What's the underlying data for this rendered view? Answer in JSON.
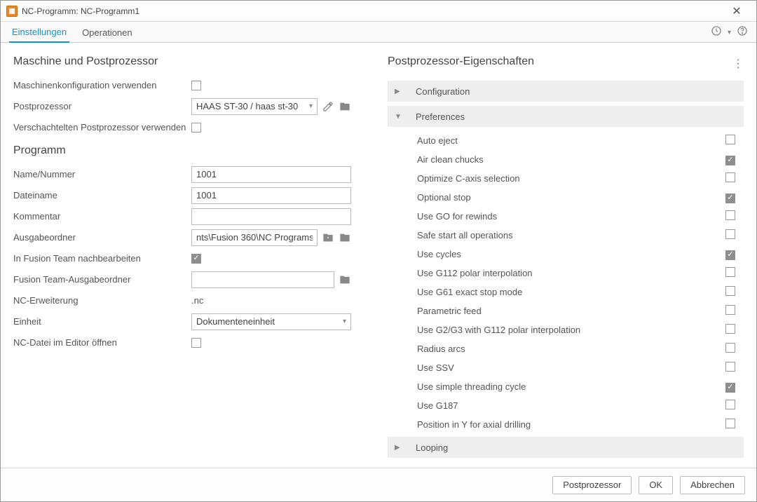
{
  "window": {
    "title": "NC-Programm: NC-Programm1"
  },
  "tabs": {
    "settings": "Einstellungen",
    "operations": "Operationen"
  },
  "left": {
    "section1_title": "Maschine und Postprozessor",
    "machine_config_label": "Maschinenkonfiguration verwenden",
    "machine_config_checked": false,
    "postprocessor_label": "Postprozessor",
    "postprocessor_value": "HAAS ST-30 / haas st-30",
    "nested_pp_label": "Verschachtelten Postprozessor verwenden",
    "nested_pp_checked": false,
    "section2_title": "Programm",
    "name_label": "Name/Nummer",
    "name_value": "1001",
    "filename_label": "Dateiname",
    "filename_value": "1001",
    "comment_label": "Kommentar",
    "comment_value": "",
    "outfolder_label": "Ausgabeordner",
    "outfolder_value": "nts\\Fusion 360\\NC Programs",
    "postedit_label": "In Fusion Team nachbearbeiten",
    "postedit_checked": true,
    "teamfolder_label": "Fusion Team-Ausgabeordner",
    "teamfolder_value": "",
    "ext_label": "NC-Erweiterung",
    "ext_value": ".nc",
    "unit_label": "Einheit",
    "unit_value": "Dokumenteneinheit",
    "open_editor_label": "NC-Datei im Editor öffnen",
    "open_editor_checked": false
  },
  "right": {
    "title": "Postprozessor-Eigenschaften",
    "groups": {
      "configuration": "Configuration",
      "preferences": "Preferences",
      "looping": "Looping"
    },
    "prefs": [
      {
        "label": "Auto eject",
        "checked": false
      },
      {
        "label": "Air clean chucks",
        "checked": true
      },
      {
        "label": "Optimize C-axis selection",
        "checked": false
      },
      {
        "label": "Optional stop",
        "checked": true
      },
      {
        "label": "Use GO for rewinds",
        "checked": false
      },
      {
        "label": "Safe start all operations",
        "checked": false
      },
      {
        "label": "Use cycles",
        "checked": true
      },
      {
        "label": "Use G112 polar interpolation",
        "checked": false
      },
      {
        "label": "Use G61 exact stop mode",
        "checked": false
      },
      {
        "label": "Parametric feed",
        "checked": false
      },
      {
        "label": "Use G2/G3 with G112 polar interpolation",
        "checked": false
      },
      {
        "label": "Radius arcs",
        "checked": false
      },
      {
        "label": "Use SSV",
        "checked": false
      },
      {
        "label": "Use simple threading cycle",
        "checked": true
      },
      {
        "label": "Use G187",
        "checked": false
      },
      {
        "label": "Position in Y for axial drilling",
        "checked": false
      }
    ]
  },
  "footer": {
    "post": "Postprozessor",
    "ok": "OK",
    "cancel": "Abbrechen"
  }
}
